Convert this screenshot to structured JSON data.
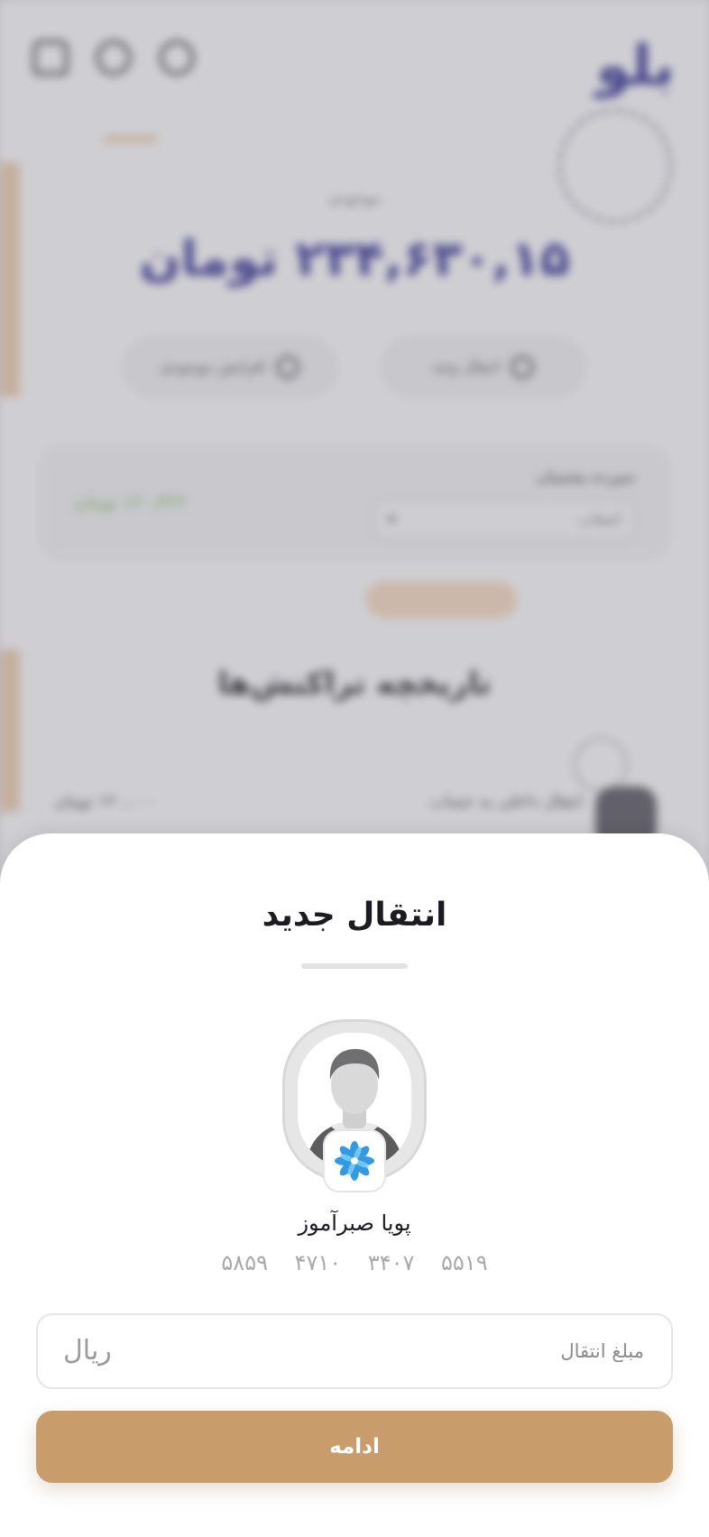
{
  "background": {
    "logo_text": "بلو",
    "balance_caption": "موجودی",
    "balance_amount": "۲۳۴,۶۳۰,۱۵ تومان",
    "actions": [
      "افزایش موجودی",
      "انتقال وجه"
    ],
    "card_title": "سپرده پشتیبان",
    "card_select_value": "انتخاب",
    "card_value": "۱۶۰,۴۲۲ تومان",
    "history_title": "تاریخچه تراکنش‌ها",
    "row_title": "انتقال داخلی به حساب",
    "row_value": "۱۲۰,۰۰۰ تومان"
  },
  "sheet": {
    "title": "انتقال جدید",
    "recipient": {
      "name": "پویا صبرآموز",
      "card_number": [
        "۵۸۵۹",
        "۴۷۱۰",
        "۳۴۰۷",
        "۵۵۱۹"
      ],
      "bank_icon": "bank-logo-icon",
      "avatar_icon": "user-avatar-icon"
    },
    "amount_field": {
      "placeholder": "مبلغ انتقال",
      "value": "",
      "unit": "ریال"
    },
    "continue_label": "ادامه"
  },
  "colors": {
    "primary_button": "#c99c6b",
    "sheet_background": "#ffffff",
    "brand": "#3b3894"
  }
}
